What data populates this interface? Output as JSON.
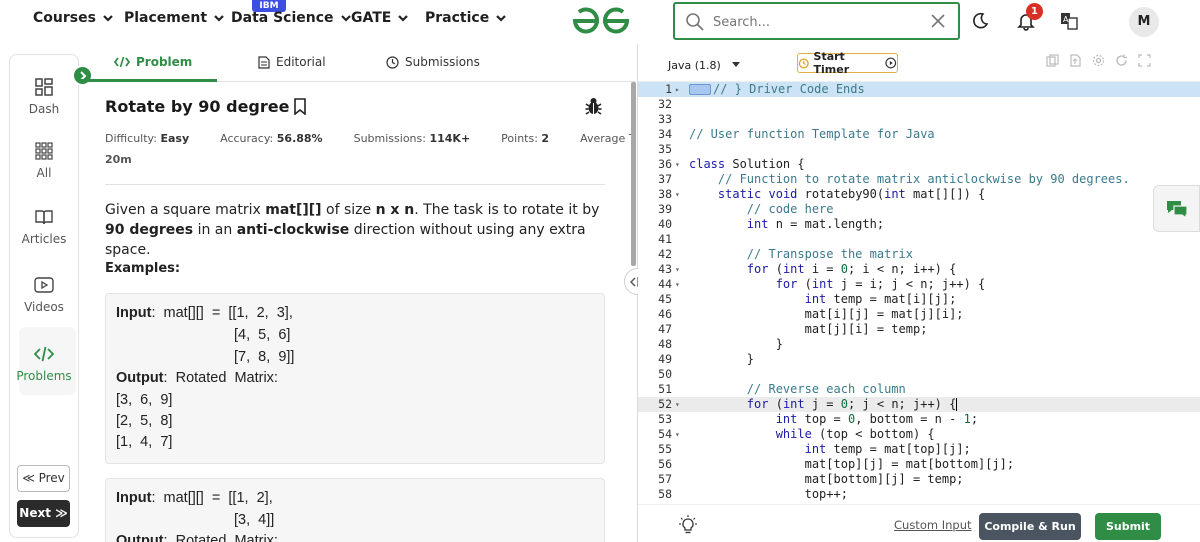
{
  "topnav": {
    "items": [
      {
        "label": "Courses"
      },
      {
        "label": "Placement"
      },
      {
        "label": "Data Science"
      },
      {
        "label": "GATE"
      },
      {
        "label": "Practice"
      }
    ],
    "ibm_badge": "IBM",
    "search_placeholder": "Search...",
    "notification_count": "1",
    "avatar_initial": "M",
    "brand_color": "#2f8d46"
  },
  "rail": {
    "items": [
      {
        "label": "Dash"
      },
      {
        "label": "All"
      },
      {
        "label": "Articles"
      },
      {
        "label": "Videos"
      },
      {
        "label": "Problems"
      }
    ],
    "prev": "≪ Prev",
    "next": "Next ≫"
  },
  "tabs": {
    "problem": "Problem",
    "editorial": "Editorial",
    "submissions": "Submissions"
  },
  "problem": {
    "title": "Rotate by 90 degree",
    "difficulty_label": "Difficulty:",
    "difficulty": "Easy",
    "accuracy_label": "Accuracy:",
    "accuracy": "56.88%",
    "submissions_label": "Submissions:",
    "submissions": "114K+",
    "points_label": "Points:",
    "points": "2",
    "avg_time_label": "Average Time:",
    "avg_time": "20m",
    "desc_1": "Given a square matrix ",
    "desc_b1": "mat[][]",
    "desc_2": " of size ",
    "desc_b2": "n x n",
    "desc_3": ". The task is to rotate it by ",
    "desc_b3": "90 degrees",
    "desc_4": " in an ",
    "desc_b4": "anti-clockwise",
    "desc_5": " direction without using any extra space.",
    "examples_label": "Examples:",
    "example1": {
      "input_label": "Input",
      "input_line1": ":  mat[][]  =  [[1,  2,  3],",
      "input_line2": "[4,  5,  6]",
      "input_line3": "[7,  8,  9]]",
      "output_label": "Output",
      "output_line1": ":  Rotated  Matrix:",
      "output_line2": "[3,  6,  9]",
      "output_line3": "[2,  5,  8]",
      "output_line4": "[1,  4,  7]"
    },
    "example2": {
      "input_label": "Input",
      "input_line1": ":  mat[][]  =  [[1,  2],",
      "input_line2": "[3,  4]]",
      "output_label": "Output",
      "output_line1": ":  Rotated  Matrix:"
    }
  },
  "editor": {
    "language": "Java (1.8)",
    "timer_label": "Start Timer",
    "lines": [
      {
        "n": "1",
        "fold": "▸",
        "text": "// } Driver Code Ends"
      },
      {
        "n": "32",
        "fold": "",
        "text": ""
      },
      {
        "n": "33",
        "fold": "",
        "text": ""
      },
      {
        "n": "34",
        "fold": "",
        "text": "// User function Template for Java"
      },
      {
        "n": "35",
        "fold": "",
        "text": ""
      },
      {
        "n": "36",
        "fold": "▾",
        "text": "class Solution {"
      },
      {
        "n": "37",
        "fold": "",
        "text": "    // Function to rotate matrix anticlockwise by 90 degrees."
      },
      {
        "n": "38",
        "fold": "▾",
        "text": "    static void rotateby90(int mat[][]) {"
      },
      {
        "n": "39",
        "fold": "",
        "text": "        // code here"
      },
      {
        "n": "40",
        "fold": "",
        "text": "        int n = mat.length;"
      },
      {
        "n": "41",
        "fold": "",
        "text": ""
      },
      {
        "n": "42",
        "fold": "",
        "text": "        // Transpose the matrix"
      },
      {
        "n": "43",
        "fold": "▾",
        "text": "        for (int i = 0; i < n; i++) {"
      },
      {
        "n": "44",
        "fold": "▾",
        "text": "            for (int j = i; j < n; j++) {"
      },
      {
        "n": "45",
        "fold": "",
        "text": "                int temp = mat[i][j];"
      },
      {
        "n": "46",
        "fold": "",
        "text": "                mat[i][j] = mat[j][i];"
      },
      {
        "n": "47",
        "fold": "",
        "text": "                mat[j][i] = temp;"
      },
      {
        "n": "48",
        "fold": "",
        "text": "            }"
      },
      {
        "n": "49",
        "fold": "",
        "text": "        }"
      },
      {
        "n": "50",
        "fold": "",
        "text": ""
      },
      {
        "n": "51",
        "fold": "",
        "text": "        // Reverse each column"
      },
      {
        "n": "52",
        "fold": "▾",
        "text": "        for (int j = 0; j < n; j++) {"
      },
      {
        "n": "53",
        "fold": "",
        "text": "            int top = 0, bottom = n - 1;"
      },
      {
        "n": "54",
        "fold": "▾",
        "text": "            while (top < bottom) {"
      },
      {
        "n": "55",
        "fold": "",
        "text": "                int temp = mat[top][j];"
      },
      {
        "n": "56",
        "fold": "",
        "text": "                mat[top][j] = mat[bottom][j];"
      },
      {
        "n": "57",
        "fold": "",
        "text": "                mat[bottom][j] = temp;"
      },
      {
        "n": "58",
        "fold": "",
        "text": "                top++;"
      }
    ],
    "custom_input": "Custom Input",
    "compile_run": "Compile & Run",
    "submit": "Submit"
  }
}
